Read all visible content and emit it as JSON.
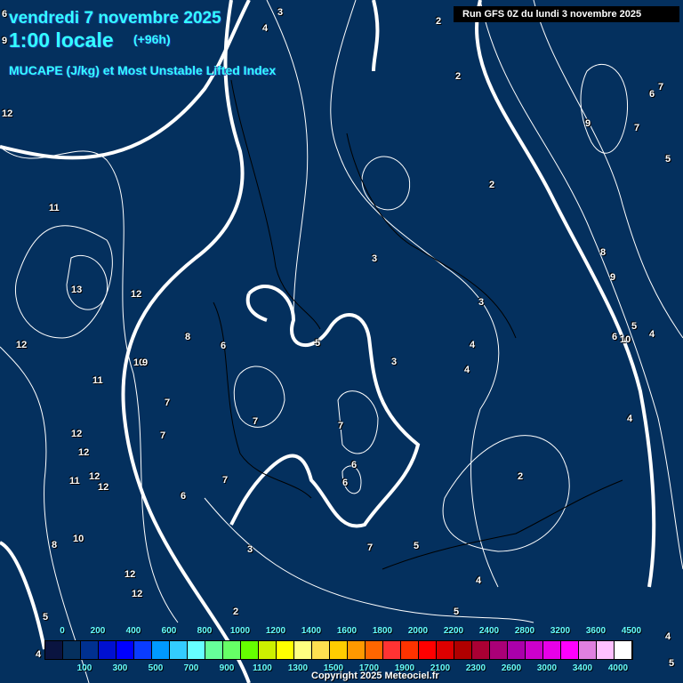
{
  "header": {
    "date": "vendredi 7 novembre 2025",
    "hour": "1:00 locale",
    "lead": "(+96h)",
    "title": "MUCAPE (J/kg) et Most Unstable Lifted Index",
    "run": "Run GFS 0Z du lundi 3 novembre 2025"
  },
  "contour_labels": [
    "6",
    "9",
    "12",
    "11",
    "13",
    "12",
    "12",
    "10",
    "9",
    "11",
    "12",
    "12",
    "11",
    "12",
    "12",
    "8",
    "10",
    "12",
    "12",
    "5",
    "4",
    "7",
    "7",
    "8",
    "6",
    "7",
    "7",
    "6",
    "6",
    "3",
    "2",
    "3",
    "4",
    "3",
    "2",
    "2",
    "5",
    "4",
    "7",
    "6",
    "7",
    "5",
    "3",
    "4",
    "4",
    "3",
    "4",
    "2",
    "5",
    "9",
    "7",
    "6",
    "5",
    "7",
    "8",
    "9",
    "5",
    "6",
    "10",
    "4",
    "2",
    "4",
    "5"
  ],
  "legend": {
    "top_labels": [
      "0",
      "200",
      "400",
      "600",
      "800",
      "1000",
      "1200",
      "1400",
      "1600",
      "1800",
      "2000",
      "2200",
      "2400",
      "2800",
      "3200",
      "3600",
      "4500"
    ],
    "bottom_labels": [
      "100",
      "300",
      "500",
      "700",
      "900",
      "1100",
      "1300",
      "1500",
      "1700",
      "1900",
      "2100",
      "2300",
      "2600",
      "3000",
      "3400",
      "4000"
    ],
    "colors": [
      "#0a1440",
      "#05305e",
      "#003090",
      "#0010d0",
      "#0000ff",
      "#0a3cff",
      "#0099ff",
      "#33ccff",
      "#66ffff",
      "#66ff99",
      "#66ff66",
      "#66ff00",
      "#ccf000",
      "#ffff00",
      "#ffff80",
      "#ffe050",
      "#ffcc00",
      "#ff9900",
      "#ff6600",
      "#ff3333",
      "#ff3300",
      "#ff0000",
      "#dd0000",
      "#b00000",
      "#aa0033",
      "#aa0077",
      "#aa00aa",
      "#cc00cc",
      "#e800e8",
      "#ff00ff",
      "#e080e0",
      "#ffc0ff",
      "#ffffff"
    ]
  },
  "copyright": "Copyright 2025 Meteociel.fr"
}
